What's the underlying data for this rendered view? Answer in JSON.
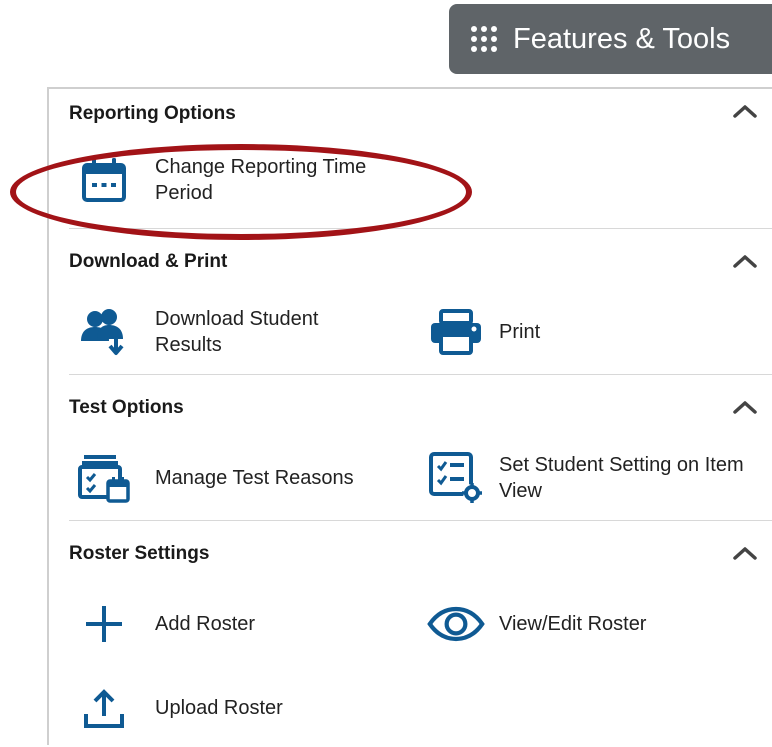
{
  "header": {
    "features_tools_label": "Features & Tools",
    "icon": "grid-dots-icon"
  },
  "colors": {
    "accent_blue": "#0f5a93",
    "header_bg": "#5f6468",
    "annotation_red": "#a21317"
  },
  "sections": [
    {
      "title": "Reporting Options",
      "tools": [
        {
          "label": "Change Reporting Time Period",
          "icon": "calendar-icon"
        }
      ]
    },
    {
      "title": "Download & Print",
      "tools": [
        {
          "label": "Download Student Results",
          "icon": "download-users-icon"
        },
        {
          "label": "Print",
          "icon": "printer-icon"
        }
      ]
    },
    {
      "title": "Test Options",
      "tools": [
        {
          "label": "Manage Test Reasons",
          "icon": "test-reasons-icon"
        },
        {
          "label": "Set Student Setting on Item View",
          "icon": "student-setting-icon"
        }
      ]
    },
    {
      "title": "Roster Settings",
      "tools": [
        {
          "label": "Add Roster",
          "icon": "plus-icon"
        },
        {
          "label": "View/Edit Roster",
          "icon": "eye-icon"
        },
        {
          "label": "Upload Roster",
          "icon": "upload-icon"
        }
      ]
    }
  ]
}
